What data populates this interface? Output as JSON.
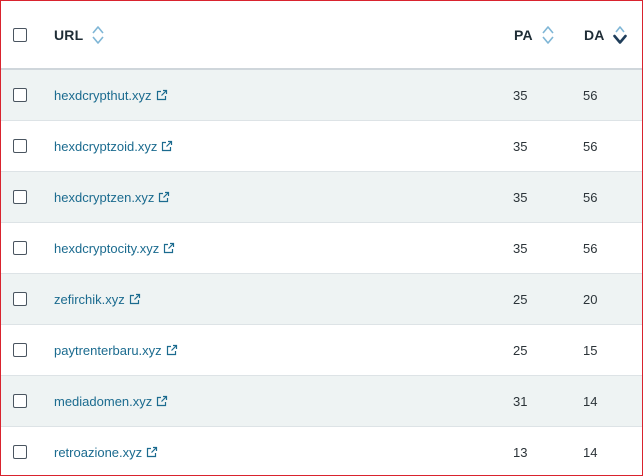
{
  "table": {
    "headers": {
      "url": "URL",
      "pa": "PA",
      "da": "DA"
    },
    "sort": {
      "url": "none",
      "pa": "none",
      "da": "descending"
    },
    "colors": {
      "link": "#1b6b8f",
      "sort_inactive": "#7fb6d6",
      "sort_active": "#1f3d5a",
      "row_alt": "#eef3f3",
      "border_accent": "#d9232e"
    },
    "rows": [
      {
        "url": "hexdcrypthut.xyz",
        "pa": "35",
        "da": "56"
      },
      {
        "url": "hexdcryptzoid.xyz",
        "pa": "35",
        "da": "56"
      },
      {
        "url": "hexdcryptzen.xyz",
        "pa": "35",
        "da": "56"
      },
      {
        "url": "hexdcryptocity.xyz",
        "pa": "35",
        "da": "56"
      },
      {
        "url": "zefirchik.xyz",
        "pa": "25",
        "da": "20"
      },
      {
        "url": "paytrenterbaru.xyz",
        "pa": "25",
        "da": "15"
      },
      {
        "url": "mediadomen.xyz",
        "pa": "31",
        "da": "14"
      },
      {
        "url": "retroazione.xyz",
        "pa": "13",
        "da": "14"
      }
    ]
  }
}
